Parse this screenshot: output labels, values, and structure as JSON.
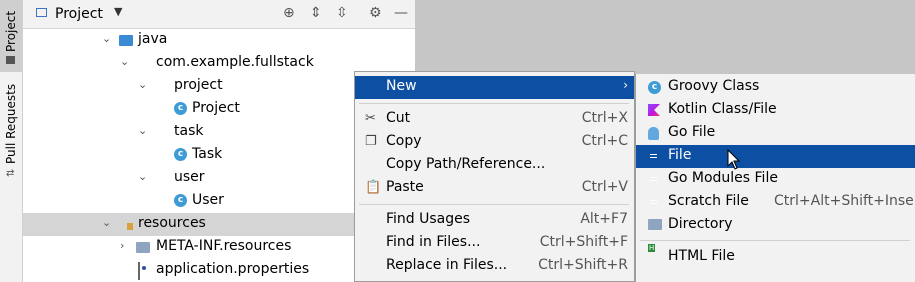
{
  "sidebar": {
    "tabs": [
      {
        "label": "Project",
        "active": true
      },
      {
        "label": "Pull Requests",
        "active": false
      }
    ]
  },
  "panel": {
    "title": "Project",
    "tree": [
      {
        "label": "java",
        "icon": "folder-blue",
        "chevron": "down",
        "depth": 0
      },
      {
        "label": "com.example.fullstack",
        "icon": "package",
        "chevron": "down",
        "depth": 1
      },
      {
        "label": "project",
        "icon": "package",
        "chevron": "down",
        "depth": 2
      },
      {
        "label": "Project",
        "icon": "class",
        "chevron": "",
        "depth": 3
      },
      {
        "label": "task",
        "icon": "package",
        "chevron": "down",
        "depth": 2
      },
      {
        "label": "Task",
        "icon": "class",
        "chevron": "",
        "depth": 3
      },
      {
        "label": "user",
        "icon": "package",
        "chevron": "down",
        "depth": 2
      },
      {
        "label": "User",
        "icon": "class",
        "chevron": "",
        "depth": 3
      },
      {
        "label": "resources",
        "icon": "resources-folder",
        "chevron": "down",
        "depth": 0,
        "selected": true
      },
      {
        "label": "META-INF.resources",
        "icon": "folder",
        "chevron": "right",
        "depth": 1
      },
      {
        "label": "application.properties",
        "icon": "properties-file",
        "chevron": "",
        "depth": 1
      }
    ]
  },
  "context_menu": {
    "items": [
      {
        "label": "New",
        "shortcut": "",
        "submenu": true,
        "highlighted": true,
        "icon": ""
      },
      {
        "label": "Cut",
        "shortcut": "Ctrl+X",
        "icon": "scissors-icon"
      },
      {
        "label": "Copy",
        "shortcut": "Ctrl+C",
        "icon": "copy-icon"
      },
      {
        "label": "Copy Path/Reference...",
        "shortcut": "",
        "icon": ""
      },
      {
        "label": "Paste",
        "shortcut": "Ctrl+V",
        "icon": "paste-icon"
      },
      {
        "label": "Find Usages",
        "shortcut": "Alt+F7",
        "icon": ""
      },
      {
        "label": "Find in Files...",
        "shortcut": "Ctrl+Shift+F",
        "icon": ""
      },
      {
        "label": "Replace in Files...",
        "shortcut": "Ctrl+Shift+R",
        "icon": ""
      }
    ]
  },
  "submenu": {
    "items": [
      {
        "label": "Groovy Class",
        "shortcut": "",
        "icon": "groovy-class-icon"
      },
      {
        "label": "Kotlin Class/File",
        "shortcut": "",
        "icon": "kotlin-icon"
      },
      {
        "label": "Go File",
        "shortcut": "",
        "icon": "go-file-icon"
      },
      {
        "label": "File",
        "shortcut": "",
        "icon": "file-icon",
        "highlighted": true
      },
      {
        "label": "Go Modules File",
        "shortcut": "",
        "icon": "file-icon"
      },
      {
        "label": "Scratch File",
        "shortcut": "Ctrl+Alt+Shift+Insert",
        "icon": "scratch-file-icon"
      },
      {
        "label": "Directory",
        "shortcut": "",
        "icon": "folder-icon"
      },
      {
        "label": "HTML File",
        "shortcut": "",
        "icon": "html-file-icon"
      }
    ]
  },
  "colors": {
    "highlight": "#0d4fa3",
    "selection": "#d5d5d5",
    "menu_bg": "#f2f2f2"
  }
}
